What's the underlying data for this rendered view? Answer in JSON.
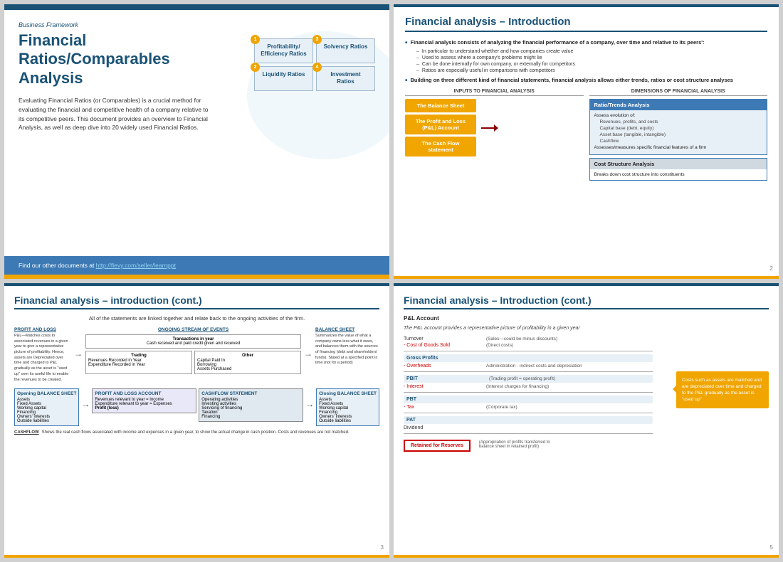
{
  "slide1": {
    "top_label": "Business Framework",
    "title": "Financial Ratios/Comparables Analysis",
    "description": "Evaluating Financial Ratios (or Comparables) is a crucial method for evaluating the financial and competitive health of a company relative to its competitive peers.  This document provides an overview to Financial Analysis, as well as deep dive into 20 widely used Financial Ratios.",
    "boxes": [
      {
        "num": "1",
        "label": "Profitability/ Efficiency Ratios"
      },
      {
        "num": "3",
        "label": "Solvency Ratios"
      },
      {
        "num": "2",
        "label": "Liquidity Ratios"
      },
      {
        "num": "4",
        "label": "Investment Ratios"
      }
    ],
    "footer_text": "Find our other documents at ",
    "footer_link": "http://flevy.com/seller/learnppt"
  },
  "slide2": {
    "title": "Financial analysis – Introduction",
    "main_bullets": [
      {
        "text": "Financial analysis consists of analyzing the financial performance of a company, over time and relative to its peers':",
        "subs": [
          "In particular to understand whether and how companies create value",
          "Used to assess where a company's problems might lie",
          "Can be done internally for own company, or externally for competitors",
          "Ratios are especially useful in comparisons with competitors"
        ]
      },
      {
        "text": "Building on three different kind of financial statements, financial analysis allows either trends, ratios or cost structure analyses",
        "subs": []
      }
    ],
    "inputs_label": "INPUTS TO FINANCIAL ANALYSIS",
    "dims_label": "DIMENSIONS OF FINANCIAL ANALYSIS",
    "input_boxes": [
      "The Balance Sheet",
      "The Profit and Loss (P&L) Account",
      "The Cash Flow statement"
    ],
    "ratio_header": "Ratio/Trends Analysis",
    "ratio_items": [
      "Assess evolution of:",
      "Revenues, profits, and costs",
      "Capital base (debt, equity)",
      "Asset base (tangible, intangible)",
      "Cashflow",
      "Assesses/measures specific financial features of a firm"
    ],
    "cost_header": "Cost Structure Analysis",
    "cost_item": "Breaks down cost structure into constituents",
    "page_num": "2"
  },
  "slide3": {
    "title": "Financial analysis – introduction (cont.)",
    "subtitle": "All of the statements are linked together and relate back to the ongoing activities of the firm.",
    "pl_label": "PROFIT AND LOSS",
    "pl_desc": "P&L—Matches costs to associated revenues in a given year to give a representative picture of profitability. Hence, assets are Depreciated over time and charged to P&L gradually as the asset is \"used up\" over its useful life to enable the revenues to be created.",
    "ongoing_label": "ONGOING STREAM OF EVENTS",
    "transactions_label": "Transactions in year",
    "transactions_desc": "Cash received and paid credit given and received",
    "trading_label": "Trading",
    "trading_items": [
      "Revenues Recorded in Year",
      "Expenditure Recorded in Year"
    ],
    "other_label": "Other",
    "other_items": [
      "Capital Paid In",
      "Borrowing",
      "Assets Purchased"
    ],
    "balance_label": "BALANCE SHEET",
    "balance_desc": "Summarizes the value of what a company owns less what it owes, and balances them with the sources of financing (debt and shareholders' funds). Stated at a specified point in time (not for a period)",
    "opening_label": "Opening BALANCE SHEET",
    "opening_items": [
      "Assets",
      "Fixed Assets",
      "Working capital",
      "Financing",
      "Owners' interests",
      "Outside liabilities"
    ],
    "pl_account_label": "PROFIT AND LOSS ACCOUNT",
    "pl_account_items": [
      "Revenues relevant to year = Income",
      "Expenditure relevant to year = Expenses",
      "Profit (loss)"
    ],
    "cashflow_label": "CASHFLOW STATEMENT",
    "cashflow_items": [
      "Operating activities",
      "Investing activities",
      "Servicing of financing",
      "Taxation",
      "Financing"
    ],
    "closing_label": "Closing BALANCE SHEET",
    "closing_items": [
      "Assets",
      "Fixed Assets",
      "Working capital",
      "Financing",
      "Owners' interests",
      "Outside liabilities"
    ],
    "cashflow_note_label": "CASHFLOW",
    "cashflow_note": "Shows the real cash flows associated with income and expenses in a given year, to show the actual change in cash position. Costs and revenues are not matched.",
    "page_num": "3"
  },
  "slide4": {
    "title": "Financial analysis – Introduction (cont.)",
    "pl_label": "P&L Account",
    "subtitle": "The P&L account provides a representative picture of profitability in a given year",
    "rows": [
      {
        "item": "Turnover",
        "desc": "(Sales—could be minus discounts)"
      },
      {
        "item": "- Cost of Goods Sold",
        "desc": "(Direct costs)"
      },
      {
        "item": "Gross Profits",
        "desc": "",
        "bold": true
      },
      {
        "item": "- Overheads",
        "desc": ""
      },
      {
        "item": "PBIT",
        "desc": "",
        "bold": true
      },
      {
        "item": "- Interest",
        "desc": "(Interest charges for financing)"
      },
      {
        "item": "PBT",
        "desc": "",
        "bold": true
      },
      {
        "item": "- Tax",
        "desc": "(Corporate tax)"
      },
      {
        "item": "PAT",
        "desc": "",
        "bold": true
      },
      {
        "item": "Dividend",
        "desc": ""
      },
      {
        "item": "Retained for Reserves",
        "desc": "(Appropriation of profits transferred to balance sheet in retained profit)",
        "highlight": true
      }
    ],
    "callout": "Costs such as assets are matched and are depreciated over time and charged to the P&L gradually as the asset is \"used up\"",
    "page_num": "5"
  }
}
